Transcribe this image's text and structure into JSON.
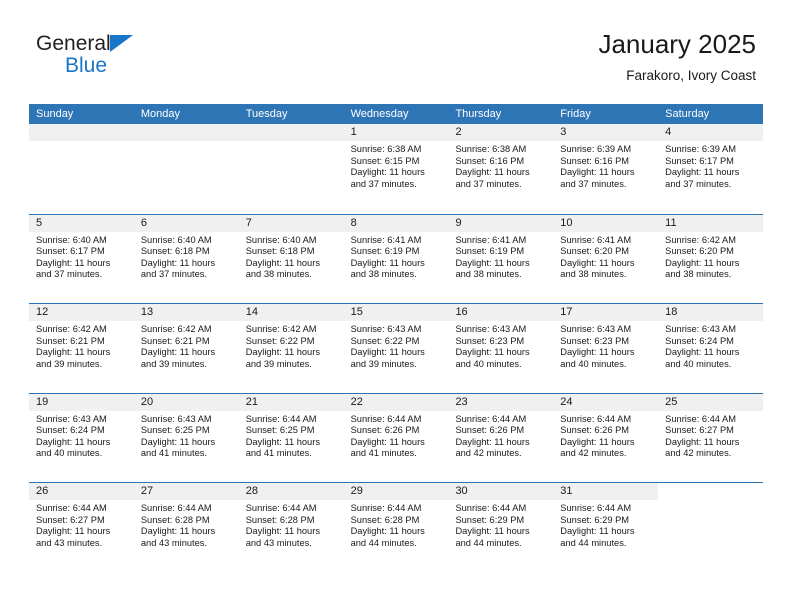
{
  "brand": {
    "line1": "General",
    "line2": "Blue",
    "triangle_color": "#1876c8"
  },
  "header": {
    "title": "January 2025",
    "subtitle": "Farakoro, Ivory Coast"
  },
  "colors": {
    "header_blue": "#2e75b6",
    "row_divider": "#2e75b6",
    "datenum_band": "#f0f0f0",
    "text": "#1a1a1a",
    "weekday_text": "#ffffff"
  },
  "weekdays": [
    "Sunday",
    "Monday",
    "Tuesday",
    "Wednesday",
    "Thursday",
    "Friday",
    "Saturday"
  ],
  "labels": {
    "sunrise": "Sunrise:",
    "sunset": "Sunset:",
    "daylight": "Daylight:"
  },
  "weeks": [
    [
      {
        "day": "",
        "sunrise": "",
        "sunset": "",
        "daylight": ""
      },
      {
        "day": "",
        "sunrise": "",
        "sunset": "",
        "daylight": ""
      },
      {
        "day": "",
        "sunrise": "",
        "sunset": "",
        "daylight": ""
      },
      {
        "day": "1",
        "sunrise": "Sunrise: 6:38 AM",
        "sunset": "Sunset: 6:15 PM",
        "daylight": "Daylight: 11 hours and 37 minutes."
      },
      {
        "day": "2",
        "sunrise": "Sunrise: 6:38 AM",
        "sunset": "Sunset: 6:16 PM",
        "daylight": "Daylight: 11 hours and 37 minutes."
      },
      {
        "day": "3",
        "sunrise": "Sunrise: 6:39 AM",
        "sunset": "Sunset: 6:16 PM",
        "daylight": "Daylight: 11 hours and 37 minutes."
      },
      {
        "day": "4",
        "sunrise": "Sunrise: 6:39 AM",
        "sunset": "Sunset: 6:17 PM",
        "daylight": "Daylight: 11 hours and 37 minutes."
      }
    ],
    [
      {
        "day": "5",
        "sunrise": "Sunrise: 6:40 AM",
        "sunset": "Sunset: 6:17 PM",
        "daylight": "Daylight: 11 hours and 37 minutes."
      },
      {
        "day": "6",
        "sunrise": "Sunrise: 6:40 AM",
        "sunset": "Sunset: 6:18 PM",
        "daylight": "Daylight: 11 hours and 37 minutes."
      },
      {
        "day": "7",
        "sunrise": "Sunrise: 6:40 AM",
        "sunset": "Sunset: 6:18 PM",
        "daylight": "Daylight: 11 hours and 38 minutes."
      },
      {
        "day": "8",
        "sunrise": "Sunrise: 6:41 AM",
        "sunset": "Sunset: 6:19 PM",
        "daylight": "Daylight: 11 hours and 38 minutes."
      },
      {
        "day": "9",
        "sunrise": "Sunrise: 6:41 AM",
        "sunset": "Sunset: 6:19 PM",
        "daylight": "Daylight: 11 hours and 38 minutes."
      },
      {
        "day": "10",
        "sunrise": "Sunrise: 6:41 AM",
        "sunset": "Sunset: 6:20 PM",
        "daylight": "Daylight: 11 hours and 38 minutes."
      },
      {
        "day": "11",
        "sunrise": "Sunrise: 6:42 AM",
        "sunset": "Sunset: 6:20 PM",
        "daylight": "Daylight: 11 hours and 38 minutes."
      }
    ],
    [
      {
        "day": "12",
        "sunrise": "Sunrise: 6:42 AM",
        "sunset": "Sunset: 6:21 PM",
        "daylight": "Daylight: 11 hours and 39 minutes."
      },
      {
        "day": "13",
        "sunrise": "Sunrise: 6:42 AM",
        "sunset": "Sunset: 6:21 PM",
        "daylight": "Daylight: 11 hours and 39 minutes."
      },
      {
        "day": "14",
        "sunrise": "Sunrise: 6:42 AM",
        "sunset": "Sunset: 6:22 PM",
        "daylight": "Daylight: 11 hours and 39 minutes."
      },
      {
        "day": "15",
        "sunrise": "Sunrise: 6:43 AM",
        "sunset": "Sunset: 6:22 PM",
        "daylight": "Daylight: 11 hours and 39 minutes."
      },
      {
        "day": "16",
        "sunrise": "Sunrise: 6:43 AM",
        "sunset": "Sunset: 6:23 PM",
        "daylight": "Daylight: 11 hours and 40 minutes."
      },
      {
        "day": "17",
        "sunrise": "Sunrise: 6:43 AM",
        "sunset": "Sunset: 6:23 PM",
        "daylight": "Daylight: 11 hours and 40 minutes."
      },
      {
        "day": "18",
        "sunrise": "Sunrise: 6:43 AM",
        "sunset": "Sunset: 6:24 PM",
        "daylight": "Daylight: 11 hours and 40 minutes."
      }
    ],
    [
      {
        "day": "19",
        "sunrise": "Sunrise: 6:43 AM",
        "sunset": "Sunset: 6:24 PM",
        "daylight": "Daylight: 11 hours and 40 minutes."
      },
      {
        "day": "20",
        "sunrise": "Sunrise: 6:43 AM",
        "sunset": "Sunset: 6:25 PM",
        "daylight": "Daylight: 11 hours and 41 minutes."
      },
      {
        "day": "21",
        "sunrise": "Sunrise: 6:44 AM",
        "sunset": "Sunset: 6:25 PM",
        "daylight": "Daylight: 11 hours and 41 minutes."
      },
      {
        "day": "22",
        "sunrise": "Sunrise: 6:44 AM",
        "sunset": "Sunset: 6:26 PM",
        "daylight": "Daylight: 11 hours and 41 minutes."
      },
      {
        "day": "23",
        "sunrise": "Sunrise: 6:44 AM",
        "sunset": "Sunset: 6:26 PM",
        "daylight": "Daylight: 11 hours and 42 minutes."
      },
      {
        "day": "24",
        "sunrise": "Sunrise: 6:44 AM",
        "sunset": "Sunset: 6:26 PM",
        "daylight": "Daylight: 11 hours and 42 minutes."
      },
      {
        "day": "25",
        "sunrise": "Sunrise: 6:44 AM",
        "sunset": "Sunset: 6:27 PM",
        "daylight": "Daylight: 11 hours and 42 minutes."
      }
    ],
    [
      {
        "day": "26",
        "sunrise": "Sunrise: 6:44 AM",
        "sunset": "Sunset: 6:27 PM",
        "daylight": "Daylight: 11 hours and 43 minutes."
      },
      {
        "day": "27",
        "sunrise": "Sunrise: 6:44 AM",
        "sunset": "Sunset: 6:28 PM",
        "daylight": "Daylight: 11 hours and 43 minutes."
      },
      {
        "day": "28",
        "sunrise": "Sunrise: 6:44 AM",
        "sunset": "Sunset: 6:28 PM",
        "daylight": "Daylight: 11 hours and 43 minutes."
      },
      {
        "day": "29",
        "sunrise": "Sunrise: 6:44 AM",
        "sunset": "Sunset: 6:28 PM",
        "daylight": "Daylight: 11 hours and 44 minutes."
      },
      {
        "day": "30",
        "sunrise": "Sunrise: 6:44 AM",
        "sunset": "Sunset: 6:29 PM",
        "daylight": "Daylight: 11 hours and 44 minutes."
      },
      {
        "day": "31",
        "sunrise": "Sunrise: 6:44 AM",
        "sunset": "Sunset: 6:29 PM",
        "daylight": "Daylight: 11 hours and 44 minutes."
      },
      {
        "day": "",
        "sunrise": "",
        "sunset": "",
        "daylight": ""
      }
    ]
  ]
}
